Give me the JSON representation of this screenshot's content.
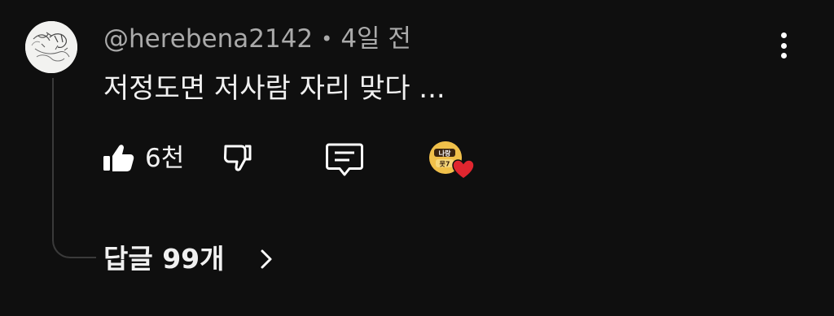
{
  "comment": {
    "username": "@herebena2142",
    "separator": "•",
    "time": "4일 전",
    "text": "저정도면 저사람 자리 맞다 ..."
  },
  "actions": {
    "like_count": "6천",
    "like_icon": "thumbs-up-filled-icon",
    "dislike_icon": "thumbs-down-icon",
    "reply_icon": "comment-bubble-icon",
    "creator_heart_icon": "creator-heart-icon",
    "creator_avatar_text": "나랑 못7"
  },
  "replies": {
    "label": "답글 99개"
  },
  "colors": {
    "background": "#0f0f0f",
    "primary_text": "#f1f1f1",
    "secondary_text": "#aaaaaa",
    "heart": "#e0262f",
    "thread_line": "#3a3a3a"
  }
}
